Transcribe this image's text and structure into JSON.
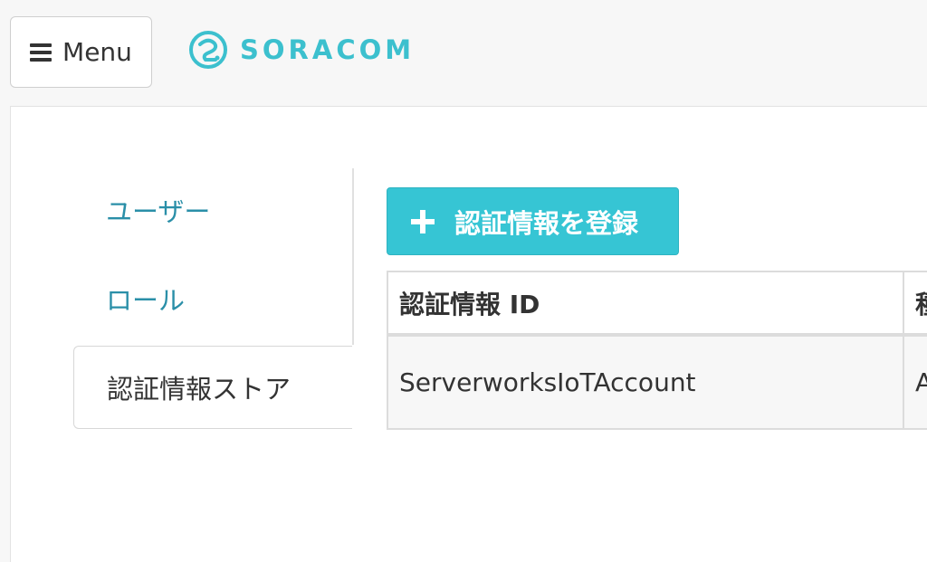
{
  "header": {
    "menu_label": "Menu",
    "logo_text": "SORACOM",
    "brand_color": "#3cc0ce"
  },
  "sidebar": {
    "items": [
      {
        "label": "ユーザー",
        "active": false
      },
      {
        "label": "ロール",
        "active": false
      },
      {
        "label": "認証情報ストア",
        "active": true
      }
    ]
  },
  "main": {
    "add_button_label": "認証情報を登録",
    "add_button_icon": "plus-icon",
    "accent_color": "#36c5d4",
    "table": {
      "columns": [
        "認証情報 ID",
        "種"
      ],
      "rows": [
        [
          "ServerworksIoTAccount",
          "A"
        ]
      ]
    }
  }
}
